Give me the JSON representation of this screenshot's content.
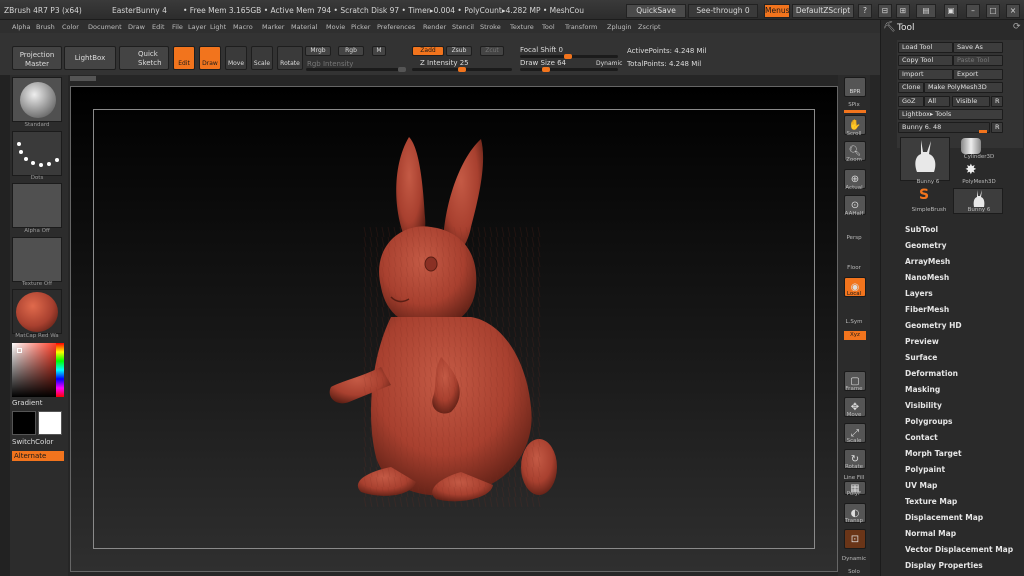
{
  "title_bar": {
    "app": "ZBrush 4R7 P3 (x64)",
    "doc": "EasterBunny 4",
    "stats": "• Free Mem 3.165GB • Active Mem 794 • Scratch Disk 97 • Timer▸0.004 • PolyCount▸4.282 MP • MeshCou",
    "quicksave": "QuickSave",
    "seethrough": "See-through 0",
    "menus": "Menus",
    "script": "DefaultZScript"
  },
  "menu_bar": [
    "Alpha",
    "Brush",
    "Color",
    "Document",
    "Draw",
    "Edit",
    "File",
    "Layer",
    "Light",
    "Macro",
    "Marker",
    "Material",
    "Movie",
    "Picker",
    "Preferences",
    "Render",
    "Stencil",
    "Stroke",
    "Texture",
    "Tool",
    "Transform",
    "Zplugin",
    "Zscript"
  ],
  "shelf": {
    "projection_master": "Projection Master",
    "lightbox": "LightBox",
    "quick_sketch": "Quick Sketch",
    "edit": "Edit",
    "draw": "Draw",
    "move": "Move",
    "scale": "Scale",
    "rotate": "Rotate",
    "mrgb": "Mrgb",
    "rgb": "Rgb",
    "m": "M",
    "rgb_intensity": "Rgb Intensity",
    "zadd": "Zadd",
    "zsub": "Zsub",
    "zcut": "Zcut",
    "z_intensity": "Z Intensity 25",
    "focal_shift": "Focal Shift 0",
    "draw_size": "Draw Size 64",
    "dynamic": "Dynamic",
    "active_points": "ActivePoints: 4.248  Mil",
    "total_points": "TotalPoints: 4.248  Mil"
  },
  "left_tray": {
    "standard": "Standard",
    "dots": "Dots",
    "alpha_off": "Alpha Off",
    "texture_off": "Texture Off",
    "matcap": "MatCap Red Wa",
    "gradient": "Gradient",
    "switchcolor": "SwitchColor",
    "alternate": "Alternate"
  },
  "right_shelf": [
    "BPR",
    "SPix",
    "Scroll",
    "Zoom",
    "Actual",
    "AAHalf",
    "Persp",
    "Floor",
    "Local",
    "L.Sym",
    "Xyz",
    "Frame",
    "Move",
    "Scale",
    "Rotate",
    "Line Fill",
    "PolyF",
    "Transp",
    "Dynamic",
    "Solo"
  ],
  "tool_panel": {
    "title": "Tool",
    "load_tool": "Load Tool",
    "save_as": "Save As",
    "copy_tool": "Copy Tool",
    "paste_tool": "Paste Tool",
    "import": "Import",
    "export": "Export",
    "clone": "Clone",
    "make_polymesh": "Make PolyMesh3D",
    "goz": "GoZ",
    "all": "All",
    "visible": "Visible",
    "r": "R",
    "lightbox_tools": "Lightbox▸ Tools",
    "current_tool": "Bunny 6. 48",
    "thumbs": [
      "Bunny 6",
      "Cylinder3D",
      "PolyMesh3D",
      "SimpleBrush",
      "Bunny 6"
    ],
    "sections": [
      "SubTool",
      "Geometry",
      "ArrayMesh",
      "NanoMesh",
      "Layers",
      "FiberMesh",
      "Geometry HD",
      "Preview",
      "Surface",
      "Deformation",
      "Masking",
      "Visibility",
      "Polygroups",
      "Contact",
      "Morph Target",
      "Polypaint",
      "UV Map",
      "Texture Map",
      "Displacement Map",
      "Normal Map",
      "Vector Displacement Map",
      "Display Properties"
    ]
  },
  "colors": {
    "accent": "#f2741d",
    "bunny": "#a8402f",
    "bg": "#262626"
  }
}
